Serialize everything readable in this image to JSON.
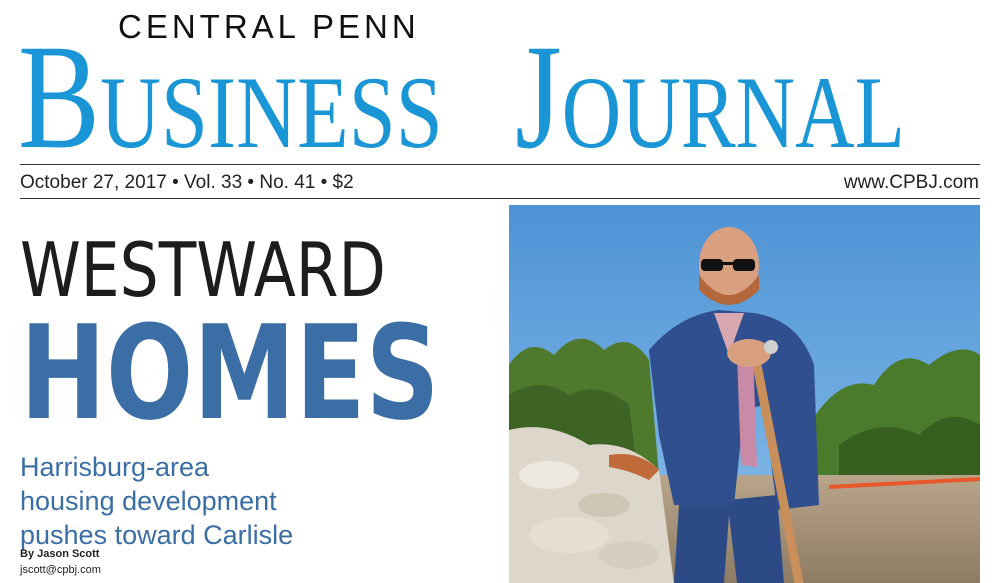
{
  "masthead": {
    "top_line": "CENTRAL PENN",
    "word1_first": "B",
    "word1_rest": "USINESS",
    "word2_first": "J",
    "word2_rest": "OURNAL"
  },
  "dateline": {
    "issue": "October 27, 2017 • Vol. 33 • No. 41 • $2",
    "website": "www.CPBJ.com"
  },
  "story": {
    "headline_line1": "WESTWARD",
    "headline_line2": "HOMES",
    "deck_lines": [
      "Harrisburg-area",
      "housing development",
      "pushes toward Carlisle"
    ],
    "byline": "By Jason Scott",
    "email": "jscott@cpbj.com"
  },
  "colors": {
    "brand_blue": "#1a96d6",
    "headline_blue": "#3a6ea5",
    "text_dark": "#1d1d1d"
  }
}
